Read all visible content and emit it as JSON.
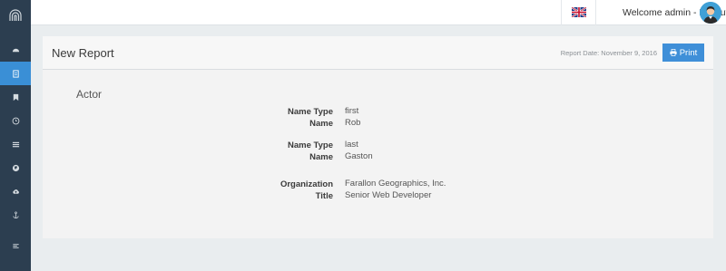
{
  "topbar": {
    "welcome_text": "Welcome admin - Logout"
  },
  "panel": {
    "title": "New Report",
    "report_date": "Report Date: November 9, 2016",
    "print_label": "Print"
  },
  "section": {
    "title": "Actor"
  },
  "fields": [
    {
      "label": "Name Type",
      "value": "first"
    },
    {
      "label": "Name",
      "value": "Rob"
    },
    {
      "label": "Name Type",
      "value": "last"
    },
    {
      "label": "Name",
      "value": "Gaston"
    },
    {
      "label": "Organization",
      "value": "Farallon Geographics, Inc."
    },
    {
      "label": "Title",
      "value": "Senior Web Developer"
    }
  ],
  "colors": {
    "sidebar_bg": "#2c3e50",
    "active_nav": "#3a8fd6",
    "primary_button": "#3f8fd8"
  },
  "icons": [
    "logo-arch-icon",
    "dashboard-icon",
    "report-icon",
    "bookmark-icon",
    "clock-icon",
    "list-icon",
    "globe-icon",
    "cloud-upload-icon",
    "anchor-icon",
    "menu-icon",
    "uk-flag-icon",
    "print-icon"
  ]
}
